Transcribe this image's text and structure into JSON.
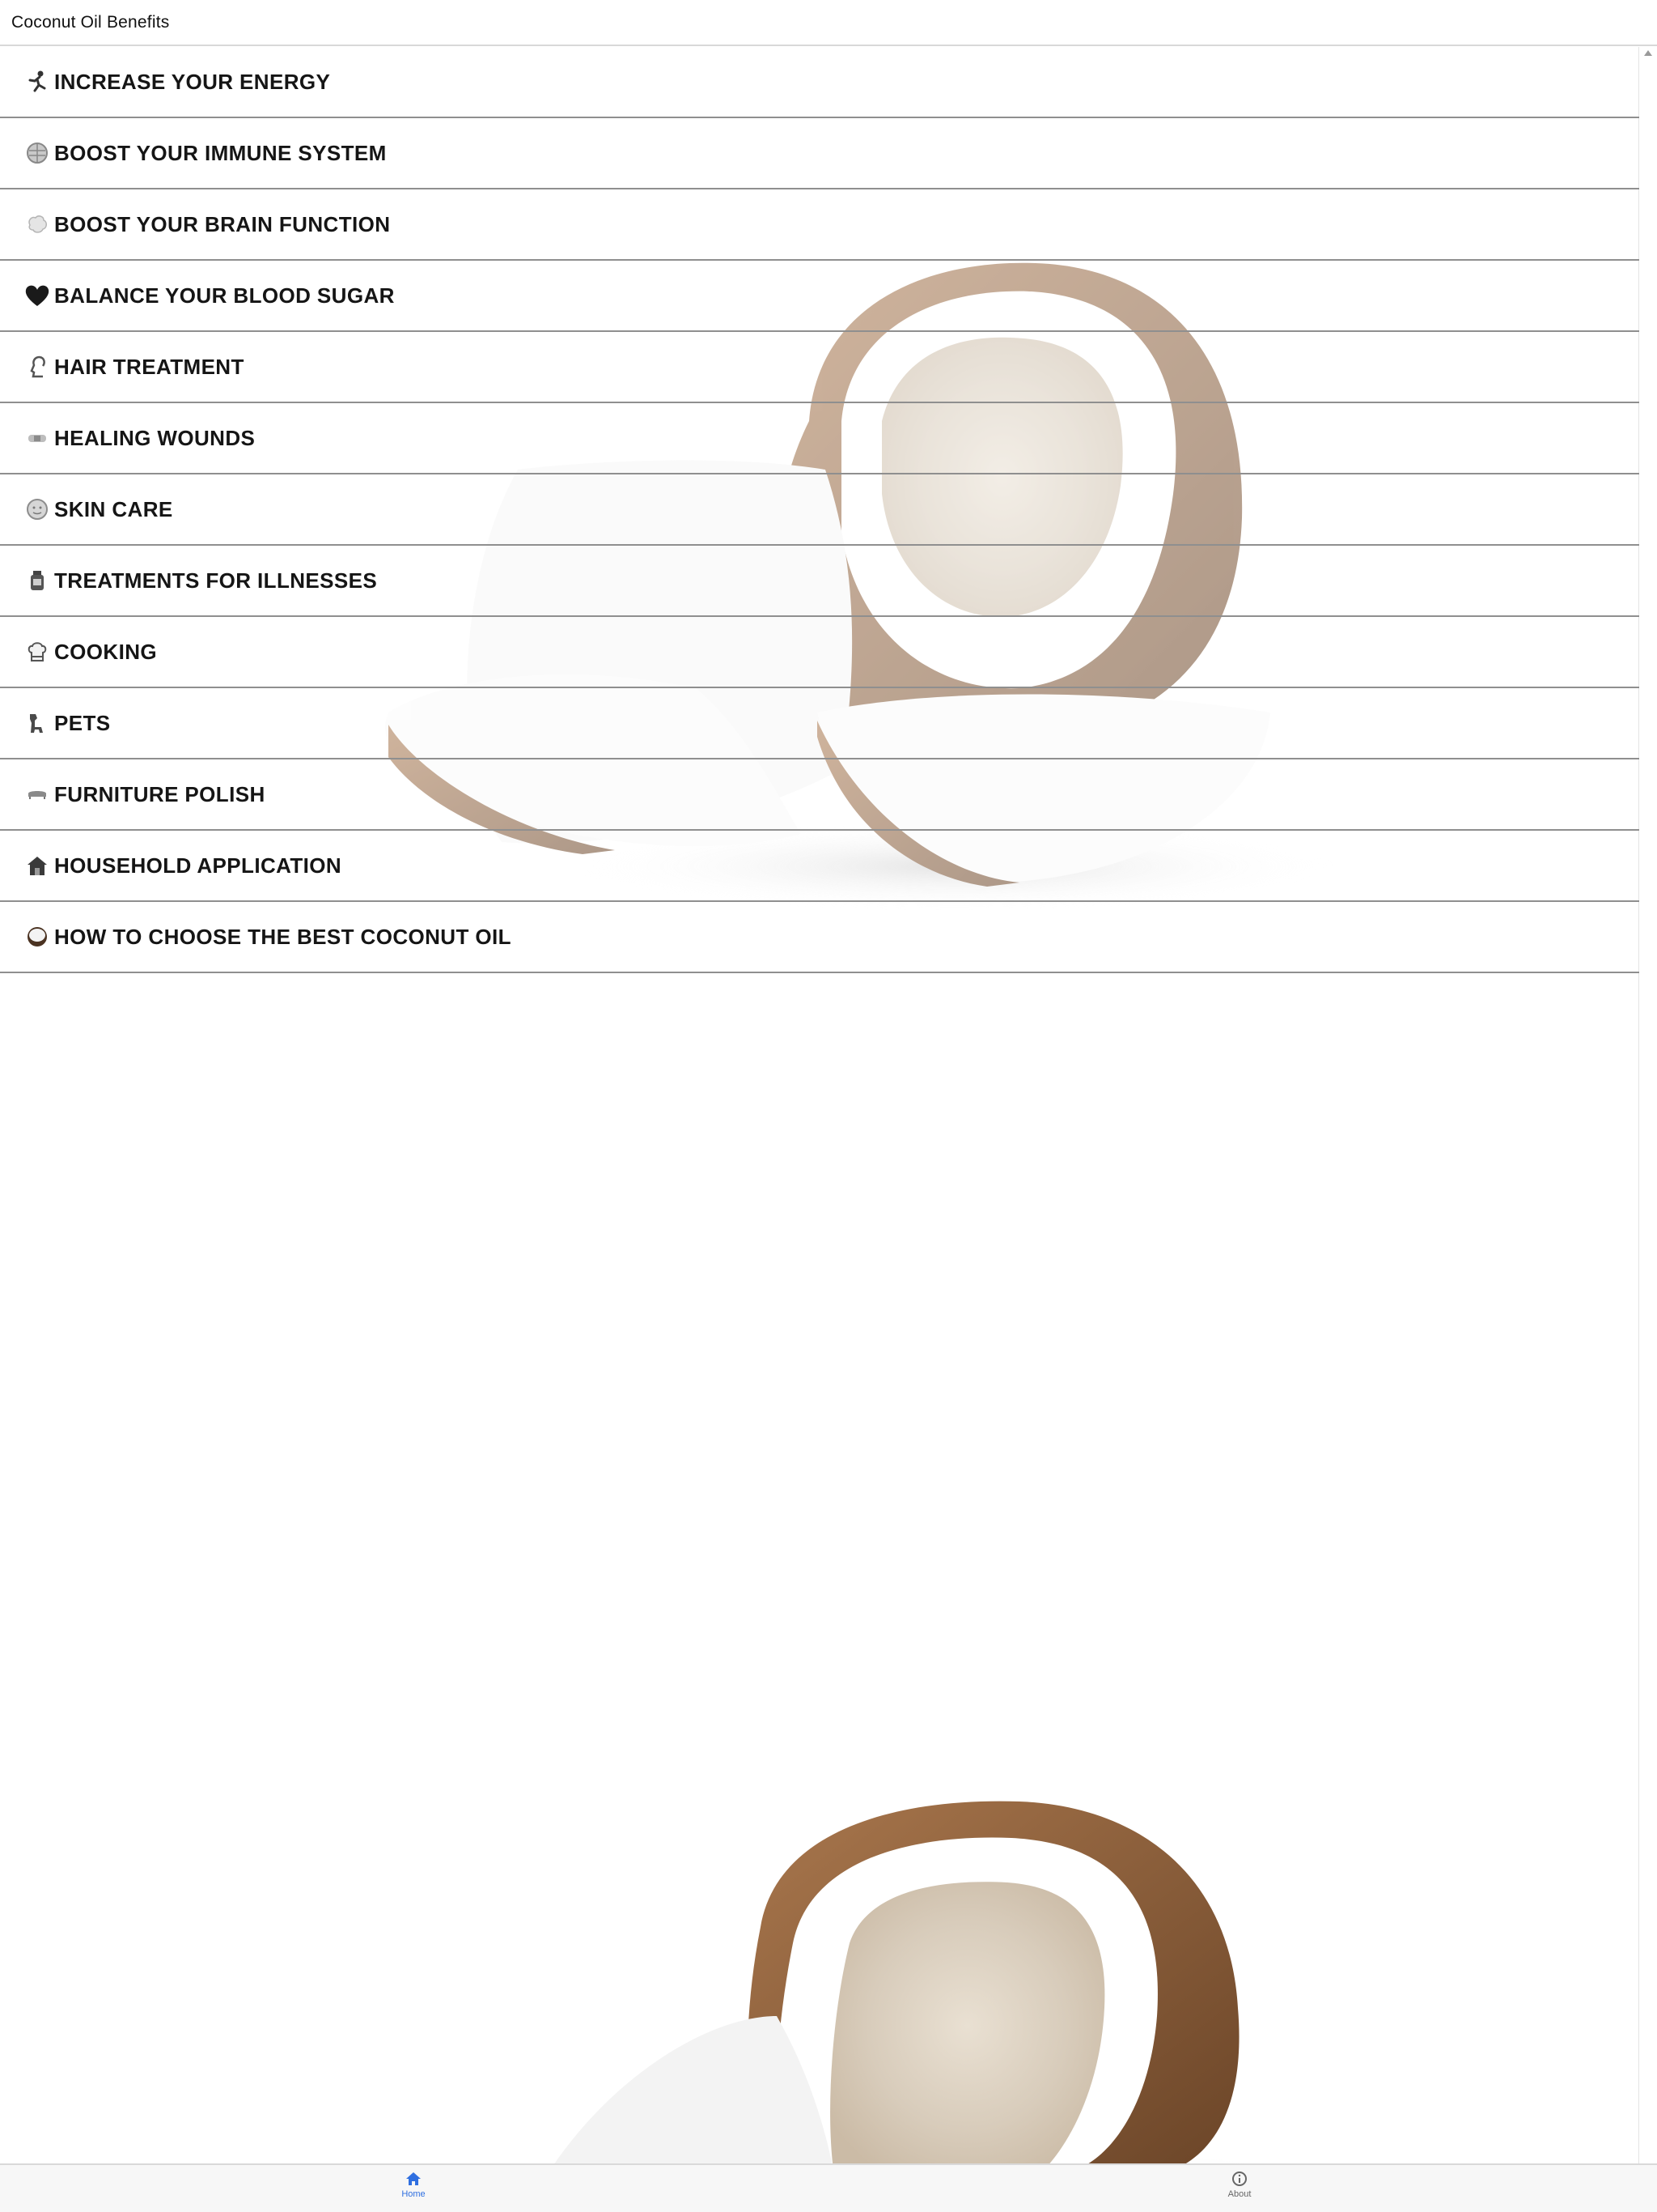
{
  "app": {
    "title": "Coconut Oil Benefits"
  },
  "menu": {
    "items": [
      {
        "label": "INCREASE YOUR ENERGY",
        "icon": "running-person-icon"
      },
      {
        "label": "BOOST YOUR IMMUNE SYSTEM",
        "icon": "shield-globe-icon"
      },
      {
        "label": "BOOST YOUR BRAIN FUNCTION",
        "icon": "brain-icon"
      },
      {
        "label": "BALANCE YOUR BLOOD SUGAR",
        "icon": "heart-icon"
      },
      {
        "label": "HAIR TREATMENT",
        "icon": "hair-icon"
      },
      {
        "label": "HEALING WOUNDS",
        "icon": "bandage-icon"
      },
      {
        "label": "SKIN CARE",
        "icon": "face-icon"
      },
      {
        "label": "TREATMENTS FOR ILLNESSES",
        "icon": "medicine-bottle-icon"
      },
      {
        "label": "COOKING",
        "icon": "chef-hat-icon"
      },
      {
        "label": "PETS",
        "icon": "dog-icon"
      },
      {
        "label": "FURNITURE POLISH",
        "icon": "sofa-icon"
      },
      {
        "label": "HOUSEHOLD APPLICATION",
        "icon": "house-icon"
      },
      {
        "label": "HOW TO CHOOSE THE BEST COCONUT OIL",
        "icon": "coconut-icon"
      }
    ]
  },
  "tabbar": {
    "tabs": [
      {
        "label": "Home",
        "icon": "home-icon",
        "active": true
      },
      {
        "label": "About",
        "icon": "info-icon",
        "active": false
      }
    ]
  },
  "colors": {
    "active_tab": "#2f6fe0",
    "row_divider": "#8f8f8f",
    "background": "#ffffff"
  }
}
